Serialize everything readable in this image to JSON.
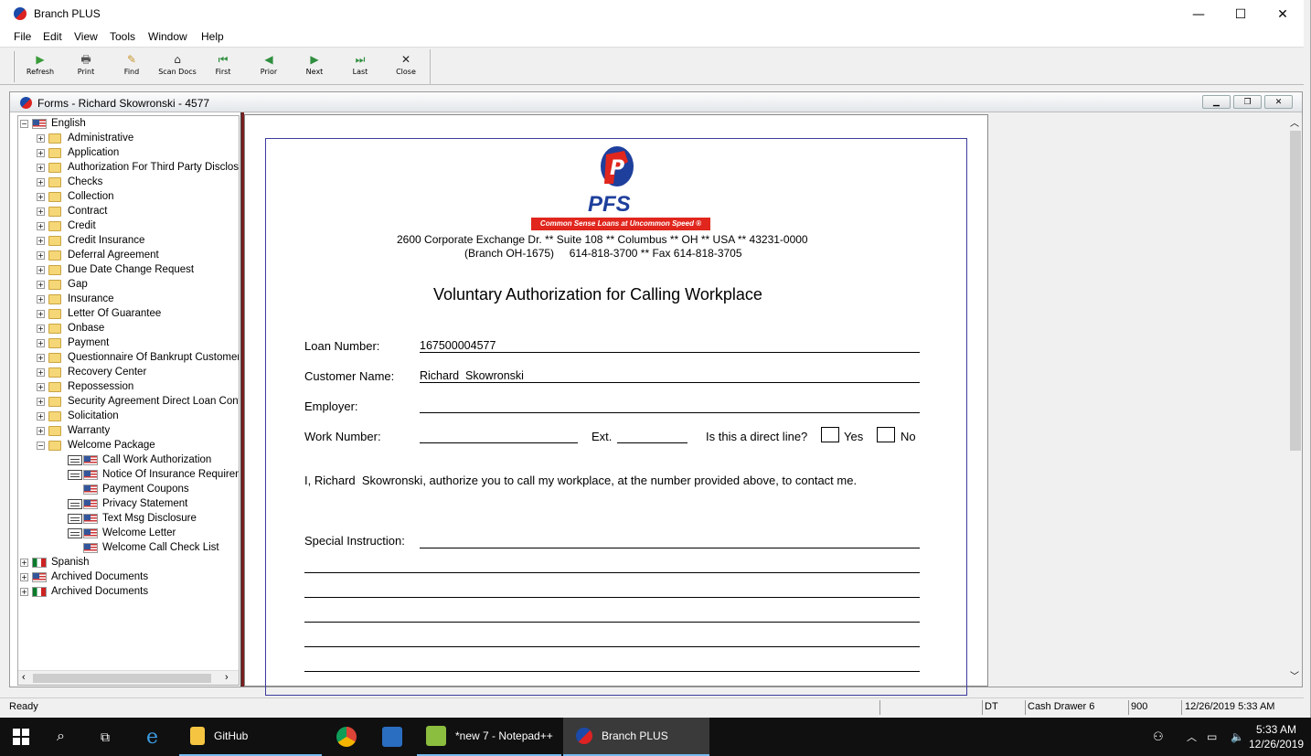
{
  "window": {
    "title": "Branch PLUS",
    "min": "—",
    "max": "☐",
    "close": "✕"
  },
  "menu": [
    "File",
    "Edit",
    "View",
    "Tools",
    "Window",
    "Help"
  ],
  "toolbar": [
    {
      "label": "Refresh",
      "icon": "refresh-icon",
      "glyph": "▶"
    },
    {
      "label": "Print",
      "icon": "printer-icon",
      "glyph": "🖶"
    },
    {
      "label": "Find",
      "icon": "find-icon",
      "glyph": "✎"
    },
    {
      "label": "Scan Docs",
      "icon": "scanner-icon",
      "glyph": "⌂"
    },
    {
      "label": "First",
      "icon": "first-icon",
      "glyph": "⏮"
    },
    {
      "label": "Prior",
      "icon": "prior-icon",
      "glyph": "◀"
    },
    {
      "label": "Next",
      "icon": "next-icon",
      "glyph": "▶"
    },
    {
      "label": "Last",
      "icon": "last-icon",
      "glyph": "⏭"
    },
    {
      "label": "Close",
      "icon": "close-icon",
      "glyph": "✕"
    }
  ],
  "child_window": {
    "title": "Forms - Richard Skowronski - 4577"
  },
  "tree": {
    "root": "English",
    "folders": [
      "Administrative",
      "Application",
      "Authorization For Third Party Disclosure",
      "Checks",
      "Collection",
      "Contract",
      "Credit",
      "Credit Insurance",
      "Deferral Agreement",
      "Due Date Change Request",
      "Gap",
      "Insurance",
      "Letter Of Guarantee",
      "Onbase",
      "Payment",
      "Questionnaire Of Bankrupt Customer",
      "Recovery Center",
      "Repossession",
      "Security Agreement Direct Loan Contract",
      "Solicitation",
      "Warranty"
    ],
    "open_folder": "Welcome Package",
    "documents": [
      {
        "label": "Call Work Authorization",
        "has_doc": true
      },
      {
        "label": "Notice Of Insurance Requirements",
        "has_doc": true
      },
      {
        "label": "Payment Coupons",
        "has_doc": false
      },
      {
        "label": "Privacy Statement",
        "has_doc": true
      },
      {
        "label": "Text Msg Disclosure",
        "has_doc": true
      },
      {
        "label": "Welcome Letter",
        "has_doc": true
      },
      {
        "label": "Welcome Call Check List",
        "has_doc": false
      }
    ],
    "other_roots": [
      {
        "label": "Spanish",
        "flag": "mx"
      },
      {
        "label": "Archived Documents",
        "flag": "us"
      },
      {
        "label": "Archived Documents",
        "flag": "mx"
      }
    ]
  },
  "form": {
    "logo_text": "PFS",
    "logo_tagline": "Common Sense Loans at Uncommon Speed ®",
    "address1": "2600 Corporate Exchange Dr. ** Suite 108 ** Columbus ** OH ** USA ** 43231-0000",
    "address2": "(Branch OH-1675)     614-818-3700 ** Fax 614-818-3705",
    "heading": "Voluntary Authorization for Calling Workplace",
    "loan_label": "Loan Number:",
    "loan_value": "167500004577",
    "customer_label": "Customer Name:",
    "customer_value": "Richard  Skowronski",
    "employer_label": "Employer:",
    "work_label": "Work Number:",
    "ext_label": "Ext.",
    "direct_label": "Is this a direct line?",
    "yes": "Yes",
    "no": "No",
    "authorization": "I, Richard  Skowronski, authorize you to call my workplace, at the number provided above, to contact me.",
    "special_label": "Special Instruction:"
  },
  "status": {
    "ready": "Ready",
    "dt": "DT",
    "drawer": "Cash Drawer 6",
    "code": "900",
    "datetime": "12/26/2019 5:33 AM"
  },
  "taskbar": {
    "items": [
      {
        "label": "GitHub",
        "icon": "folder-icon"
      },
      {
        "label": "",
        "icon": "chrome-icon"
      },
      {
        "label": "",
        "icon": "azure-icon"
      },
      {
        "label": "*new 7 - Notepad++",
        "icon": "notepad-icon"
      },
      {
        "label": "Branch PLUS",
        "icon": "branch-plus-icon"
      }
    ],
    "time": "5:33 AM",
    "date": "12/26/2019"
  }
}
